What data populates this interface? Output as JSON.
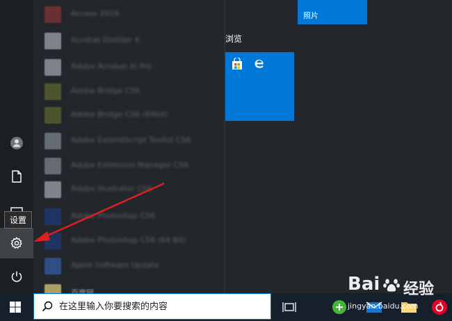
{
  "rail": {
    "tooltip": "设置"
  },
  "app_list": {
    "items": [
      {
        "name": "Access 2016",
        "color": "#a4373a"
      },
      {
        "name": "Acrobat Distiller X",
        "color": "#c9ced8"
      },
      {
        "name": "Adobe Acrobat XI Pro",
        "color": "#c9ced8"
      },
      {
        "name": "Adobe Bridge CS6",
        "color": "#6c7a2b"
      },
      {
        "name": "Adobe Bridge CS6 (64bit)",
        "color": "#6c7a2b"
      },
      {
        "name": "Adobe ExtendScript Toolkit CS6",
        "color": "#9aa3ad"
      },
      {
        "name": "Adobe Extension Manager CS6",
        "color": "#9aa3ad"
      },
      {
        "name": "Adobe Illustrator CS6",
        "color": "#c8d1da"
      },
      {
        "name": "Adobe Photoshop CS6",
        "color": "#1c3f94"
      },
      {
        "name": "Adobe Photoshop CS6 (64 Bit)",
        "color": "#1c3f94"
      },
      {
        "name": "Apple Software Update",
        "color": "#3a6fd0"
      }
    ],
    "partial_item": "百度网"
  },
  "tiles": {
    "group_label": "浏览",
    "photos_label": "照片",
    "store_icon": "microsoft-store-icon",
    "edge_icon": "edge-icon",
    "accent_color": "#0078d7"
  },
  "taskbar": {
    "search_placeholder": "在这里输入你要搜索的内容"
  },
  "watermark": {
    "brand": "Bai",
    "brand_cn": "经验",
    "url": "jingyan.baidu.com"
  }
}
